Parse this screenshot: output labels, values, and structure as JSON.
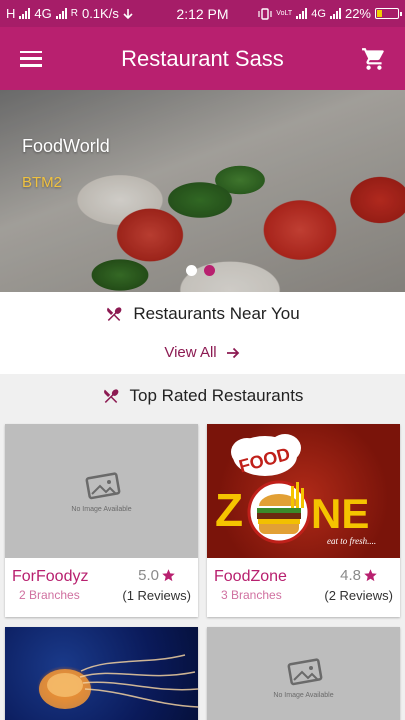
{
  "status_bar": {
    "left": "H",
    "network_1": "4G",
    "network_2": "R",
    "speed": "0.1K/s",
    "time": "2:12 PM",
    "right_tag_1": "VoLTE",
    "right_tag_2": "4G",
    "battery_percent": "22%",
    "battery_level": 0.22
  },
  "appbar": {
    "title": "Restaurant Sass",
    "menu_icon": "hamburger-menu-icon",
    "cart_icon": "shopping-cart-icon"
  },
  "hero": {
    "restaurant_name": "FoodWorld",
    "area": "BTM2",
    "slides": 2,
    "active_slide": 1
  },
  "near_you": {
    "icon": "fork-knife-icon",
    "title": "Restaurants Near You",
    "view_all": "View All",
    "arrow_icon": "arrow-right-icon"
  },
  "top_rated": {
    "icon": "fork-knife-icon",
    "title": "Top Rated Restaurants",
    "cards": [
      {
        "name": "ForFoodyz",
        "branches": "2 Branches",
        "rating": "5.0",
        "reviews": "(1 Reviews)",
        "image": "No Image Available"
      },
      {
        "name": "FoodZone",
        "branches": "3 Branches",
        "rating": "4.8",
        "reviews": "(2 Reviews)",
        "image": "foodzone-logo"
      },
      {
        "name": "",
        "branches": "",
        "rating": "",
        "reviews": "",
        "image": "jellyfish-photo"
      },
      {
        "name": "",
        "branches": "",
        "rating": "",
        "reviews": "",
        "image": "No Image Available"
      }
    ]
  },
  "logo": {
    "word_top": "FOOD",
    "word_left": "Z",
    "word_right": "NE",
    "tagline": "eat to fresh...."
  },
  "colors": {
    "primary": "#b8206f",
    "status_bar": "#a61d68",
    "accent_text": "#8c1a52",
    "area_text": "#f0c240"
  }
}
